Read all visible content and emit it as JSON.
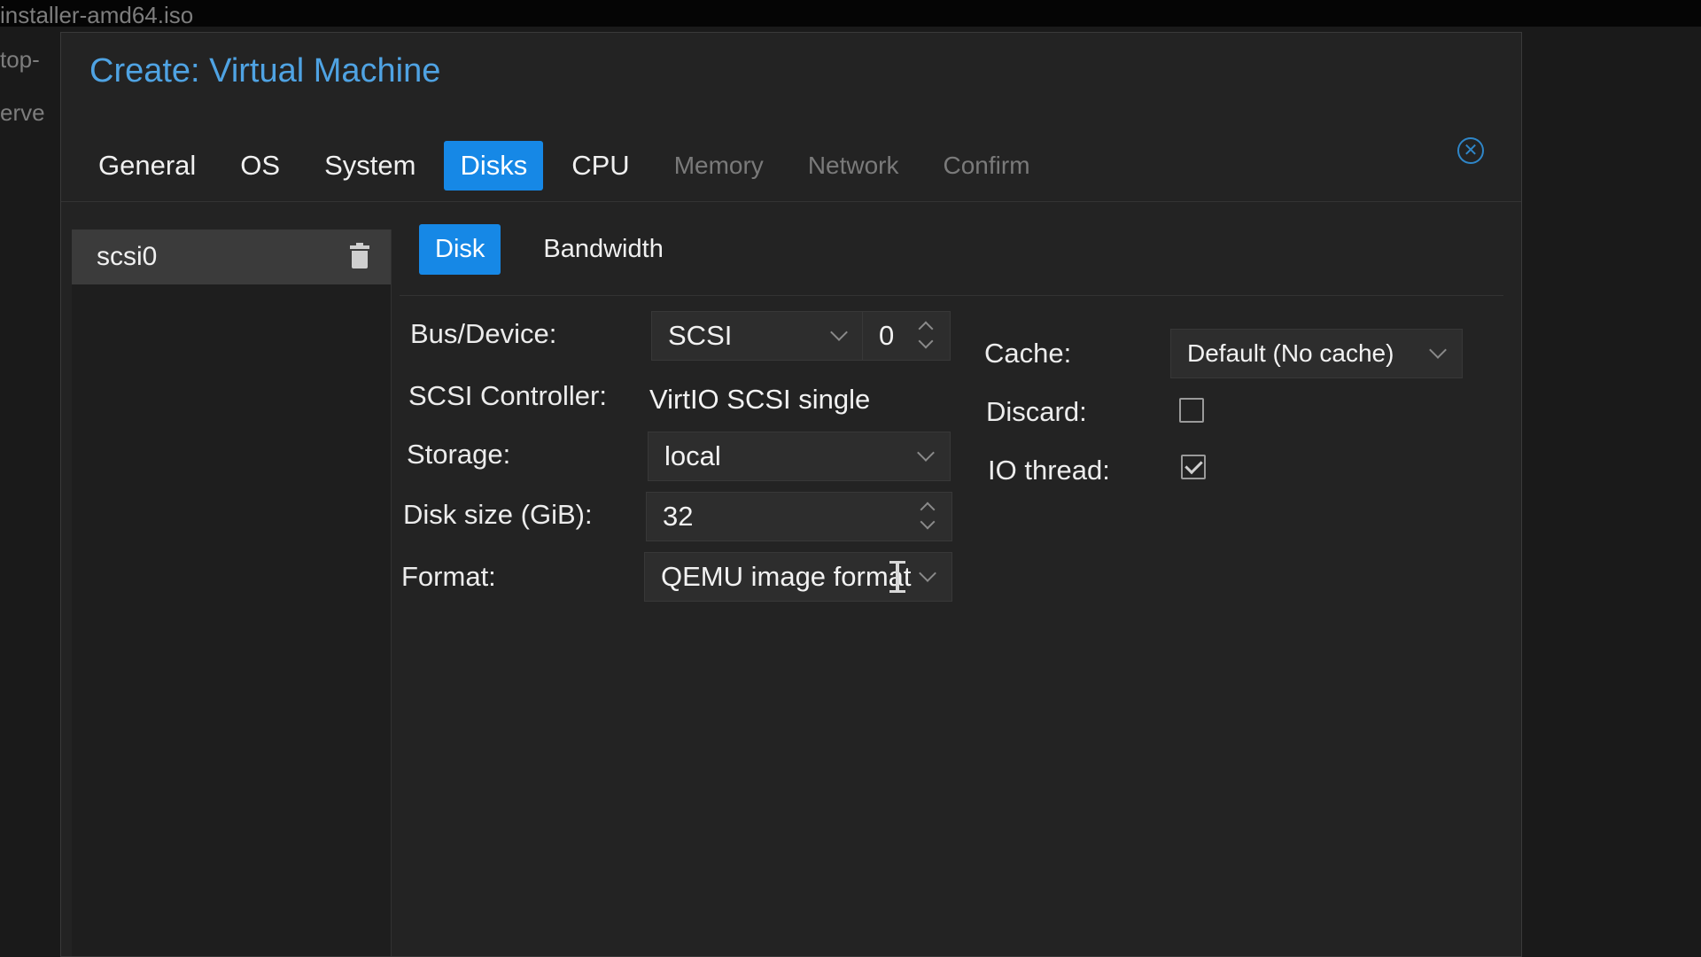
{
  "background": {
    "window_title": "installer-amd64.iso",
    "side_text_1": "top-",
    "side_text_2": "erve"
  },
  "dialog": {
    "title": "Create: Virtual Machine",
    "close_icon": "close-circle-icon",
    "tabs": [
      {
        "label": "General",
        "state": "normal"
      },
      {
        "label": "OS",
        "state": "normal"
      },
      {
        "label": "System",
        "state": "normal"
      },
      {
        "label": "Disks",
        "state": "active"
      },
      {
        "label": "CPU",
        "state": "normal"
      },
      {
        "label": "Memory",
        "state": "disabled"
      },
      {
        "label": "Network",
        "state": "disabled"
      },
      {
        "label": "Confirm",
        "state": "disabled"
      }
    ]
  },
  "disk_list": {
    "items": [
      {
        "label": "scsi0",
        "icon": "trash-icon"
      }
    ]
  },
  "subtabs": [
    {
      "label": "Disk",
      "state": "active"
    },
    {
      "label": "Bandwidth",
      "state": "normal"
    }
  ],
  "form": {
    "bus_device": {
      "label": "Bus/Device:",
      "bus": "SCSI",
      "device": "0"
    },
    "scsi_controller": {
      "label": "SCSI Controller:",
      "value": "VirtIO SCSI single"
    },
    "storage": {
      "label": "Storage:",
      "value": "local"
    },
    "disk_size": {
      "label": "Disk size (GiB):",
      "value": "32"
    },
    "format": {
      "label": "Format:",
      "value": "QEMU image format"
    },
    "cache": {
      "label": "Cache:",
      "value": "Default (No cache)"
    },
    "discard": {
      "label": "Discard:",
      "checked": false
    },
    "io_thread": {
      "label": "IO thread:",
      "checked": true
    }
  },
  "colors": {
    "accent": "#1688e6",
    "title": "#4fa3e3",
    "dialog_bg": "#232323"
  }
}
